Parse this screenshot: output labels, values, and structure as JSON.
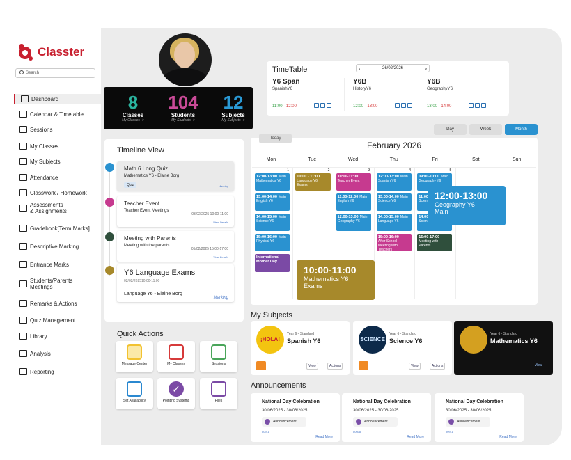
{
  "brand": {
    "name": "Classter",
    "color": "#c8202f"
  },
  "search": {
    "placeholder": "Search"
  },
  "sidebar": {
    "items": [
      {
        "label": "Dashboard",
        "icon": "laptop-icon",
        "active": true
      },
      {
        "label": "Calendar & Timetable",
        "icon": "calendar-grid-icon"
      },
      {
        "label": "Sessions",
        "icon": "presentation-icon"
      },
      {
        "label": "My Classes",
        "icon": "classes-icon"
      },
      {
        "label": "My Subjects",
        "icon": "book-icon"
      },
      {
        "label": "Attendance",
        "icon": "attendance-icon"
      },
      {
        "label": "Classwork / Homework",
        "icon": "checklist-icon"
      },
      {
        "label": "Assessments\n& Assignments",
        "icon": "assessment-icon"
      },
      {
        "label": "Gradebook[Term Marks]",
        "icon": "gradebook-icon"
      },
      {
        "label": "Descriptive Marking",
        "icon": "edit-icon"
      },
      {
        "label": "Entrance Marks",
        "icon": "entrance-icon"
      },
      {
        "label": "Students/Parents\nMeetings",
        "icon": "meetings-icon"
      },
      {
        "label": "Remarks & Actions",
        "icon": "arrows-icon"
      },
      {
        "label": "Quiz Management",
        "icon": "quiz-icon"
      },
      {
        "label": "Library",
        "icon": "library-icon"
      },
      {
        "label": "Analysis",
        "icon": "analysis-icon"
      },
      {
        "label": "Reporting",
        "icon": "report-icon"
      }
    ]
  },
  "stats": [
    {
      "value": "8",
      "label": "Classes",
      "link": "My Classes ->",
      "color": "#2bb5a0"
    },
    {
      "value": "104",
      "label": "Students",
      "link": "My Students ->",
      "color": "#c94a97"
    },
    {
      "value": "12",
      "label": "Subjects",
      "link": "My Subjects ->",
      "color": "#2a9ad6"
    }
  ],
  "timetable": {
    "title": "TimeTable",
    "date": "26/02/2026",
    "items": [
      {
        "name": "Y6 Span",
        "subject": "SpanishY6",
        "start": "11:00",
        "end": "12:00"
      },
      {
        "name": "Y6B",
        "subject": "HistoryY6",
        "start": "12:00",
        "end": "13:00"
      },
      {
        "name": "Y6B",
        "subject": "GeographyY6",
        "start": "13:00",
        "end": "14:00"
      }
    ]
  },
  "views": {
    "day": "Day",
    "week": "Week",
    "month": "Month",
    "today": "Today"
  },
  "calendar": {
    "title": "February 2026",
    "days": [
      "Mon",
      "Tue",
      "Wed",
      "Thu",
      "Fri",
      "Sat",
      "Sun"
    ],
    "dates": [
      "1",
      "2",
      "3",
      "4",
      "5"
    ],
    "events": [
      {
        "c": 0,
        "r": 0,
        "time": "12:00-13:00",
        "loc": "Main",
        "sub": "Mathematics Y6",
        "color": "#2a92d0"
      },
      {
        "c": 0,
        "r": 1,
        "time": "13:00-14:00",
        "loc": "Main",
        "sub": "English Y6",
        "color": "#2a92d0"
      },
      {
        "c": 0,
        "r": 2,
        "time": "14:00-15:00",
        "loc": "Main",
        "sub": "Science Y6",
        "color": "#2a92d0"
      },
      {
        "c": 0,
        "r": 3,
        "time": "15:00-16:00",
        "loc": "Main",
        "sub": "Physical Y6",
        "color": "#2a92d0"
      },
      {
        "c": 0,
        "r": 4,
        "time": "International Mother Day",
        "loc": "",
        "sub": "",
        "color": "#7b4aa5"
      },
      {
        "c": 1,
        "r": 0,
        "time": "10:00 - 11:00",
        "loc": "",
        "sub": "Language Y6 Exams",
        "color": "#a7892b"
      },
      {
        "c": 2,
        "r": 0,
        "time": "10:00-11:00",
        "loc": "",
        "sub": "Teacher Event",
        "color": "#c63a8f"
      },
      {
        "c": 2,
        "r": 1,
        "time": "11:00-12:00",
        "loc": "Main",
        "sub": "English Y6",
        "color": "#2a92d0"
      },
      {
        "c": 2,
        "r": 2,
        "time": "12:00-13:00",
        "loc": "Main",
        "sub": "Geography Y6",
        "color": "#2a92d0"
      },
      {
        "c": 3,
        "r": 0,
        "time": "12:00-13:00",
        "loc": "Main",
        "sub": "Spanish Y6",
        "color": "#2a92d0"
      },
      {
        "c": 3,
        "r": 1,
        "time": "13:00-14:00",
        "loc": "Main",
        "sub": "Science Y6",
        "color": "#2a92d0"
      },
      {
        "c": 3,
        "r": 2,
        "time": "14:00-15:00",
        "loc": "Main",
        "sub": "Language Y6",
        "color": "#2a92d0"
      },
      {
        "c": 3,
        "r": 3,
        "time": "15:00-16:00",
        "loc": "",
        "sub": "After School Meeting with Teachers",
        "color": "#c63a8f"
      },
      {
        "c": 4,
        "r": 0,
        "time": "09:00-10:00",
        "loc": "Main",
        "sub": "Geography Y6",
        "color": "#2a92d0"
      },
      {
        "c": 4,
        "r": 1,
        "time": "11:00-12:00",
        "loc": "Main",
        "sub": "Science Y6",
        "color": "#2a92d0"
      },
      {
        "c": 4,
        "r": 2,
        "time": "14:00-15:00",
        "loc": "Main",
        "sub": "Science Y6",
        "color": "#2a92d0"
      },
      {
        "c": 4,
        "r": 3,
        "time": "15:00-17:00",
        "loc": "",
        "sub": "Meeting with Parents",
        "color": "#2f4f3c"
      }
    ],
    "popups": [
      {
        "time": "12:00-13:00",
        "sub": "Geography Y6",
        "loc": "Main",
        "color": "#2a92d0"
      },
      {
        "time": "10:00-11:00",
        "sub": "Mathematics Y6",
        "loc": "Exams",
        "color": "#a7892b"
      }
    ]
  },
  "timeline": {
    "title": "Timeline View",
    "items": [
      {
        "title": "Math 6 Long Quiz",
        "detail": "Mathematics Y6 - Elaine Borg",
        "tag": "Quiz",
        "link": "Marking",
        "color": "#2a92d0"
      },
      {
        "title": "Teacher Event",
        "detail": "Teacher Event Meetings",
        "time": "03/02/2025 10:00-11:00",
        "link": "View Details",
        "color": "#c63a8f"
      },
      {
        "title": "Meeting with Parents",
        "detail": "Meeting with the parents",
        "time": "05/02/2025 15:00-17:00",
        "link": "View Details",
        "color": "#2f4f3c"
      },
      {
        "title": "Y6 Language Exams",
        "date": "02/02/202510:00-11:00",
        "detail": "Language Y6 - Elaine Borg",
        "link": "Marking",
        "color": "#a7892b"
      }
    ]
  },
  "quick_actions": {
    "title": "Quick Actions",
    "items": [
      {
        "label": "Message Center",
        "icon": "envelope-icon",
        "color": "#f2c230"
      },
      {
        "label": "My Classes",
        "icon": "classes-doc-icon",
        "color": "#d63a3a"
      },
      {
        "label": "Sessions",
        "icon": "sessions-icon",
        "color": "#4aa55a"
      },
      {
        "label": "Set Availability",
        "icon": "calendar-icon",
        "color": "#2a88d0"
      },
      {
        "label": "Pointing Systems",
        "icon": "check-circle-icon",
        "color": "#7b4aa5"
      },
      {
        "label": "Files",
        "icon": "files-icon",
        "color": "#7b4aa5"
      }
    ]
  },
  "my_subjects": {
    "title": "My Subjects",
    "items": [
      {
        "level": "Year 6 - Standard",
        "name": "Spanish Y6",
        "view": "View",
        "actions": "Actions",
        "img_text": "¡HOLA!"
      },
      {
        "level": "Year 6 - Standard",
        "name": "Science Y6",
        "view": "View",
        "actions": "Actions",
        "img_text": "SCIENCE"
      },
      {
        "level": "Year 6 - Standard",
        "name": "Mathematics Y6",
        "view": "View",
        "actions": "",
        "img_text": ""
      }
    ]
  },
  "announcements": {
    "title": "Announcements",
    "items": [
      {
        "title": "National Day Celebration",
        "dates": "30/06/2025 - 30/06/2025",
        "tag": "Announcement",
        "code": "#0911",
        "link": "Read More"
      },
      {
        "title": "National Day Celebration",
        "dates": "30/06/2025 - 30/06/2025",
        "tag": "Announcement",
        "code": "#0608",
        "link": "Read More"
      },
      {
        "title": "National Day Celebration",
        "dates": "30/06/2025 - 30/06/2025",
        "tag": "Announcement",
        "code": "#0911",
        "link": "Read More"
      }
    ]
  }
}
